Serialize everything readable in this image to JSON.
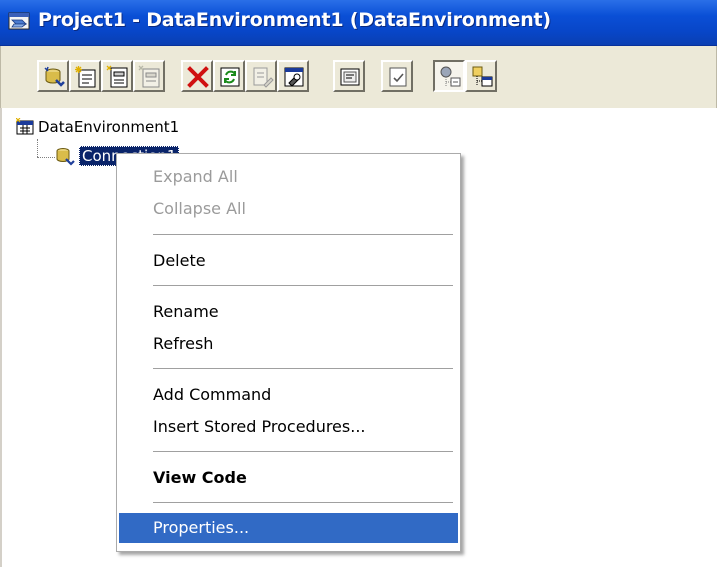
{
  "window": {
    "title": "Project1 - DataEnvironment1 (DataEnvironment)"
  },
  "toolbar": {
    "buttons": [
      {
        "icon": "add-connection-icon"
      },
      {
        "icon": "add-command-icon"
      },
      {
        "icon": "add-child-command-icon"
      },
      {
        "icon": "insert-stored-procedures-icon"
      },
      {
        "icon": "delete-icon"
      },
      {
        "icon": "refresh-icon"
      },
      {
        "icon": "design-icon"
      },
      {
        "icon": "properties-icon"
      },
      {
        "icon": "view-code-icon"
      },
      {
        "icon": "options-icon"
      },
      {
        "icon": "arrange-by-objects-icon"
      },
      {
        "icon": "arrange-by-connections-icon"
      }
    ]
  },
  "tree": {
    "root_label": "DataEnvironment1",
    "connection_label": "Connection1"
  },
  "context_menu": {
    "items": [
      {
        "label": "Expand All",
        "enabled": false
      },
      {
        "label": "Collapse All",
        "enabled": false
      },
      {
        "label": "Delete",
        "enabled": true
      },
      {
        "label": "Rename",
        "enabled": true
      },
      {
        "label": "Refresh",
        "enabled": true
      },
      {
        "label": "Add Command",
        "enabled": true
      },
      {
        "label": "Insert Stored Procedures...",
        "enabled": true
      },
      {
        "label": "View Code",
        "enabled": true,
        "default": true
      },
      {
        "label": "Properties...",
        "enabled": true,
        "highlighted": true
      }
    ]
  },
  "colors": {
    "titlebar": "#0a4fd6",
    "selection": "#0a246a",
    "menu_highlight": "#316ac5"
  }
}
